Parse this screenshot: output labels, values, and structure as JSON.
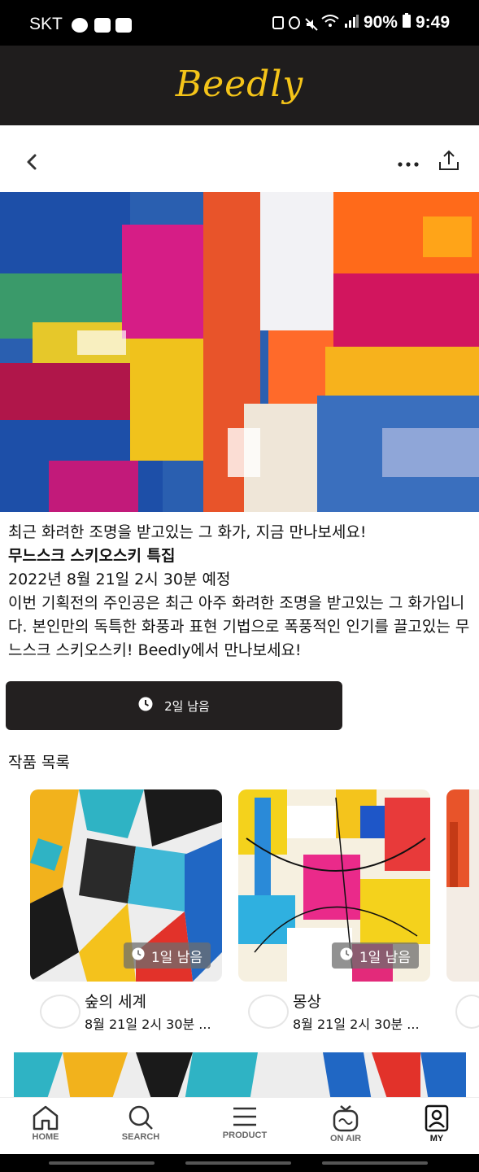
{
  "status_bar": {
    "carrier": "SKT",
    "battery": "90%",
    "time": "9:49"
  },
  "header": {
    "logo": "Beedly"
  },
  "toolbar": {
    "back_icon": "chevron-left-icon",
    "more_icon": "more-horizontal-icon",
    "share_icon": "share-icon"
  },
  "exhibition": {
    "tagline": "최근 화려한 조명을 받고있는 그 화가, 지금 만나보세요!",
    "title": "무느스크 스키오스키 특집",
    "schedule": "2022년 8월 21일 2시 30분 예정",
    "description": "이번 기획전의 주인공은 최근 아주 화려한 조명을 받고있는 그 화가입니다. 본인만의 독특한 화풍과 표현 기법으로 폭풍적인 인기를 끌고있는 무느스크 스키오스키! Beedly에서 만나보세요!",
    "countdown": "2일 남음"
  },
  "works": {
    "section_title": "작품 목록",
    "items": [
      {
        "title": "숲의 세계",
        "date": "8월 21일 2시 30분 ...",
        "badge": "1일 남음"
      },
      {
        "title": "몽상",
        "date": "8월 21일 2시 30분 ...",
        "badge": "1일 남음"
      }
    ]
  },
  "bottom_nav": {
    "items": [
      {
        "label": "HOME",
        "icon": "home-icon"
      },
      {
        "label": "SEARCH",
        "icon": "search-icon"
      },
      {
        "label": "PRODUCT",
        "icon": "menu-icon"
      },
      {
        "label": "ON AIR",
        "icon": "tv-icon"
      },
      {
        "label": "MY",
        "icon": "user-icon"
      }
    ]
  },
  "colors": {
    "brand_yellow": "#f4c419",
    "header_bg": "#1f1d1d",
    "button_bg": "#232020"
  }
}
